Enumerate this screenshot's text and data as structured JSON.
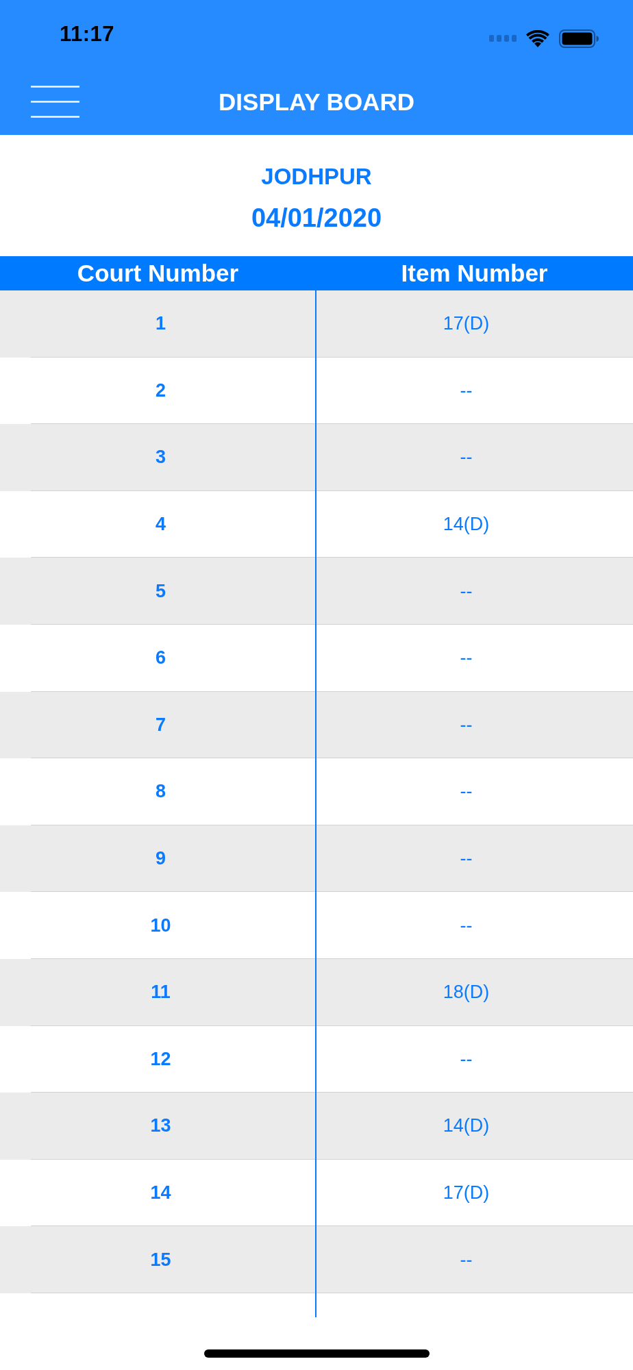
{
  "status_bar": {
    "time": "11:17"
  },
  "nav_bar": {
    "title": "DISPLAY BOARD"
  },
  "board": {
    "location": "JODHPUR",
    "date": "04/01/2020"
  },
  "table": {
    "columns": [
      "Court Number",
      "Item Number"
    ],
    "rows": [
      {
        "court_number": "1",
        "item_number": "17(D)"
      },
      {
        "court_number": "2",
        "item_number": "--"
      },
      {
        "court_number": "3",
        "item_number": "--"
      },
      {
        "court_number": "4",
        "item_number": "14(D)"
      },
      {
        "court_number": "5",
        "item_number": "--"
      },
      {
        "court_number": "6",
        "item_number": "--"
      },
      {
        "court_number": "7",
        "item_number": "--"
      },
      {
        "court_number": "8",
        "item_number": "--"
      },
      {
        "court_number": "9",
        "item_number": "--"
      },
      {
        "court_number": "10",
        "item_number": "--"
      },
      {
        "court_number": "11",
        "item_number": "18(D)"
      },
      {
        "court_number": "12",
        "item_number": "--"
      },
      {
        "court_number": "13",
        "item_number": "14(D)"
      },
      {
        "court_number": "14",
        "item_number": "17(D)"
      },
      {
        "court_number": "15",
        "item_number": "--"
      }
    ]
  }
}
